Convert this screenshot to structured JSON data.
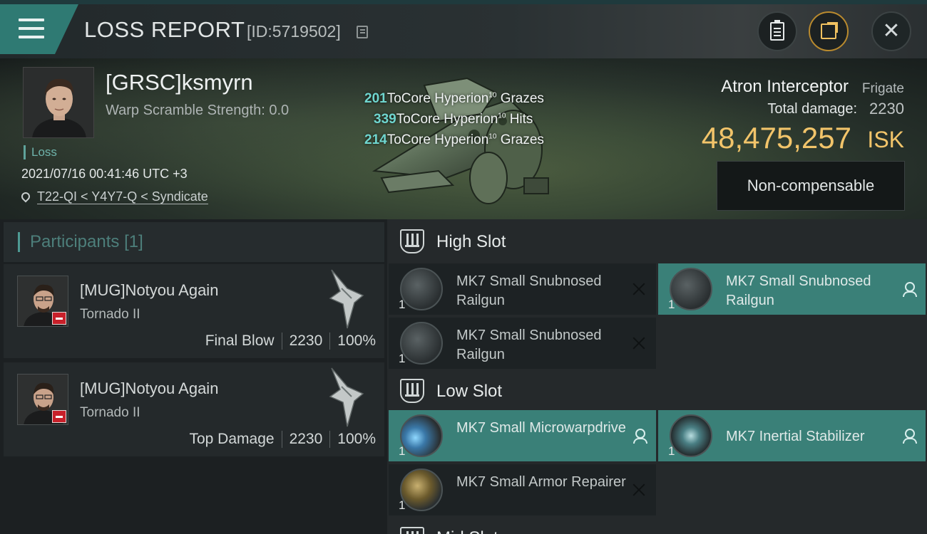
{
  "header": {
    "title": "LOSS REPORT",
    "report_id": "[ID:5719502]",
    "menu_icon": "hamburger-icon",
    "copy_icon": "copy-icon",
    "buttons": {
      "clipboard_icon": "clipboard-icon",
      "share_icon": "share-icon",
      "close_glyph": "✕"
    }
  },
  "victim": {
    "name": "[GRSC]ksmyrn",
    "warp_scramble": "Warp Scramble Strength: 0.0",
    "tag": "Loss",
    "timestamp": "2021/07/16 00:41:46 UTC +3",
    "location": "T22-QI < Y4Y7-Q < Syndicate"
  },
  "hit_log": [
    {
      "damage": "201",
      "text": "ToCore Hyperion",
      "level": "10",
      "result": "Grazes"
    },
    {
      "damage": "339",
      "text": "ToCore Hyperion",
      "level": "10",
      "result": "Hits"
    },
    {
      "damage": "214",
      "text": "ToCore Hyperion",
      "level": "10",
      "result": "Grazes"
    }
  ],
  "ship": {
    "name": "Atron Interceptor",
    "class": "Frigate",
    "total_damage_label": "Total damage:",
    "total_damage": "2230",
    "isk_value": "48,475,257",
    "isk_unit": "ISK",
    "compensation": "Non-compensable"
  },
  "participants": {
    "title": "Participants",
    "count": "[1]",
    "list": [
      {
        "name": "[MUG]Notyou Again",
        "ship": "Tornado II",
        "role": "Final Blow",
        "damage": "2230",
        "percent": "100%"
      },
      {
        "name": "[MUG]Notyou Again",
        "ship": "Tornado II",
        "role": "Top Damage",
        "damage": "2230",
        "percent": "100%"
      }
    ]
  },
  "fitting": {
    "high_slot": {
      "title": "High Slot",
      "modules": [
        {
          "name": "MK7 Small Snubnosed Railgun",
          "qty": "1",
          "status": "destroyed"
        },
        {
          "name": "MK7 Small Snubnosed Railgun",
          "qty": "1",
          "status": "dropped"
        },
        {
          "name": "MK7 Small Snubnosed Railgun",
          "qty": "1",
          "status": "destroyed"
        }
      ]
    },
    "low_slot": {
      "title": "Low Slot",
      "modules": [
        {
          "name": "MK7 Small Microwarpdrive",
          "qty": "1",
          "status": "dropped"
        },
        {
          "name": "MK7 Inertial Stabilizer",
          "qty": "1",
          "status": "dropped"
        },
        {
          "name": "MK7 Small Armor Repairer",
          "qty": "1",
          "status": "destroyed"
        }
      ]
    },
    "mid_slot": {
      "title": "Mid Slot"
    }
  },
  "colors": {
    "accent_teal": "#3a8078",
    "isk_gold": "#f2c46a",
    "loss_tag": "#6fb3ab",
    "damage_cyan": "#6fd6cf"
  }
}
